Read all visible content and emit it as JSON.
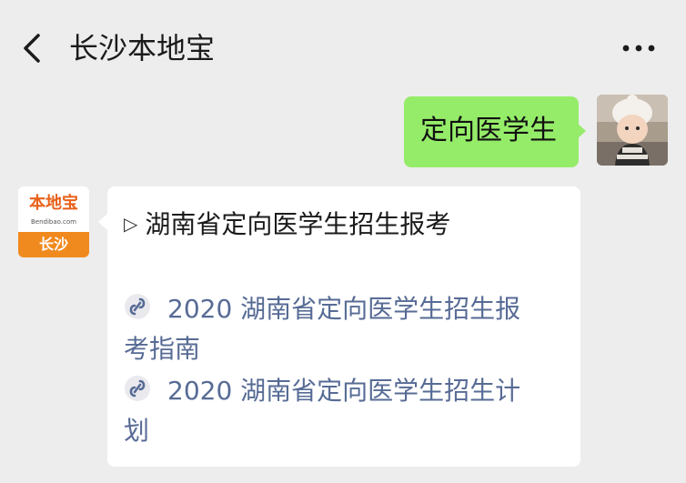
{
  "header": {
    "title": "长沙本地宝",
    "back_icon": "chevron-left-icon",
    "more_icon": "more-horizontal-icon"
  },
  "messages": {
    "user": {
      "text": "定向医学生",
      "bubble_color": "#95ec69"
    },
    "bot": {
      "heading_marker": "▷",
      "heading": "湖南省定向医学生招生报考",
      "links": [
        {
          "line1": "2020 湖南省定向医学生招生报",
          "line2": "考指南",
          "icon": "mini-program-link-icon"
        },
        {
          "line1": "2020 湖南省定向医学生招生计",
          "line2": "划",
          "icon": "mini-program-link-icon"
        }
      ],
      "link_color": "#576b95"
    }
  },
  "bot_avatar": {
    "logo_text": "本地宝",
    "logo_subtext": "Bendibao.com",
    "band_text": "长沙",
    "brand_color": "#f08a1e"
  }
}
